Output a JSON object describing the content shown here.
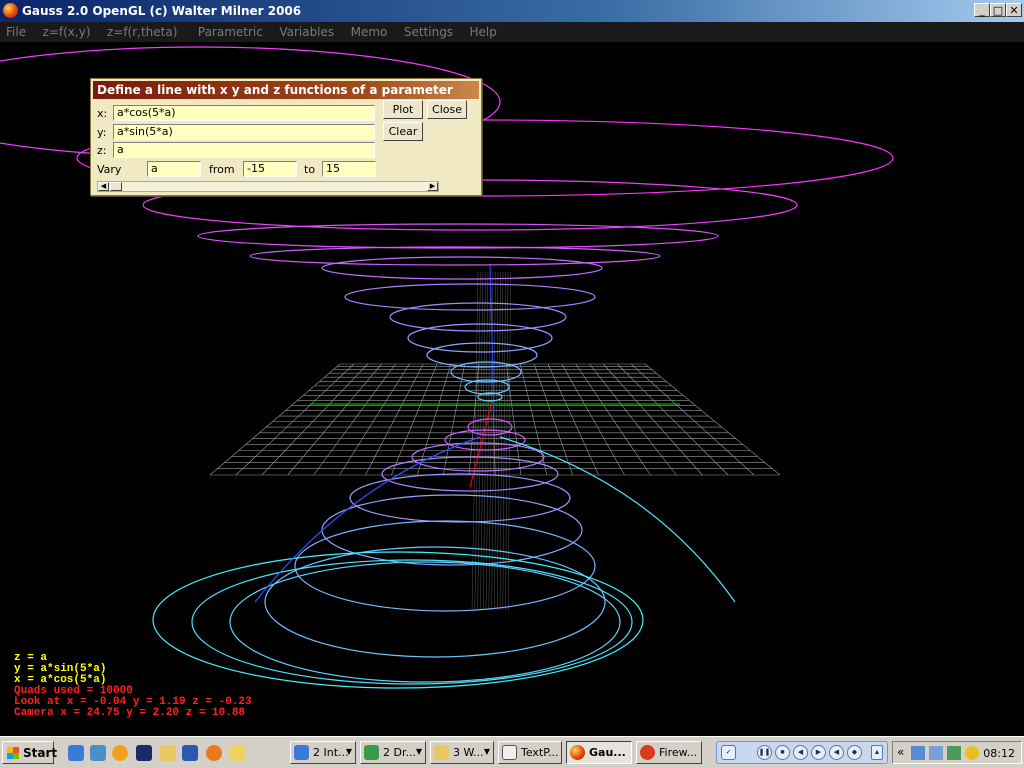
{
  "window": {
    "title": "Gauss 2.0 OpenGL (c) Walter Milner 2006",
    "buttons": {
      "minimize": "_",
      "maximize": "□",
      "close": "✕"
    }
  },
  "menu": [
    "File",
    "z=f(x,y)",
    "z=f(r,theta)",
    "Parametric",
    "Variables",
    "Memo",
    "Settings",
    "Help"
  ],
  "dialog": {
    "title": "Define a line with x y and z functions of a parameter",
    "x_label": "x:",
    "x_value": "a*cos(5*a)",
    "y_label": "y:",
    "y_value": "a*sin(5*a)",
    "z_label": "z:",
    "z_value": "a",
    "vary_label": "Vary",
    "vary_value": "a",
    "from_label": "from",
    "from_value": "-15",
    "to_label": "to",
    "to_value": "15",
    "plot_button": "Plot",
    "close_button": "Close",
    "clear_button": "Clear"
  },
  "info": {
    "z_line": "z = a",
    "y_line": "y = a*sin(5*a)",
    "x_line": "x = a*cos(5*a)",
    "quads": "Quads used = 10000",
    "look_at": "Look at x = -0.04  y =  1.19 z = -0.23",
    "camera": "Camera x = 24.75 y =  2.20  z = 10.88"
  },
  "colors": {
    "info_yellow": "#ffff00",
    "info_red": "#ff2020",
    "grid": "#9a9a9a",
    "axis_green": "#00cc00",
    "axis_red": "#ff0000",
    "axis_blue": "#2040ff",
    "curve_start": "#ff30ff",
    "curve_end": "#30ffff"
  },
  "taskbar": {
    "start": "Start",
    "tasks": [
      {
        "label": "2 Int...",
        "icon": "internet-explorer-icon"
      },
      {
        "label": "2 Dr...",
        "icon": "drawing-icon"
      },
      {
        "label": "3 W...",
        "icon": "folder-icon"
      },
      {
        "label": "TextP...",
        "icon": "textpad-icon"
      },
      {
        "label": "Gau...",
        "icon": "gauss-icon"
      },
      {
        "label": "Firew...",
        "icon": "fireworks-icon"
      }
    ],
    "tray_collapse": "«",
    "clock": "08:12"
  }
}
